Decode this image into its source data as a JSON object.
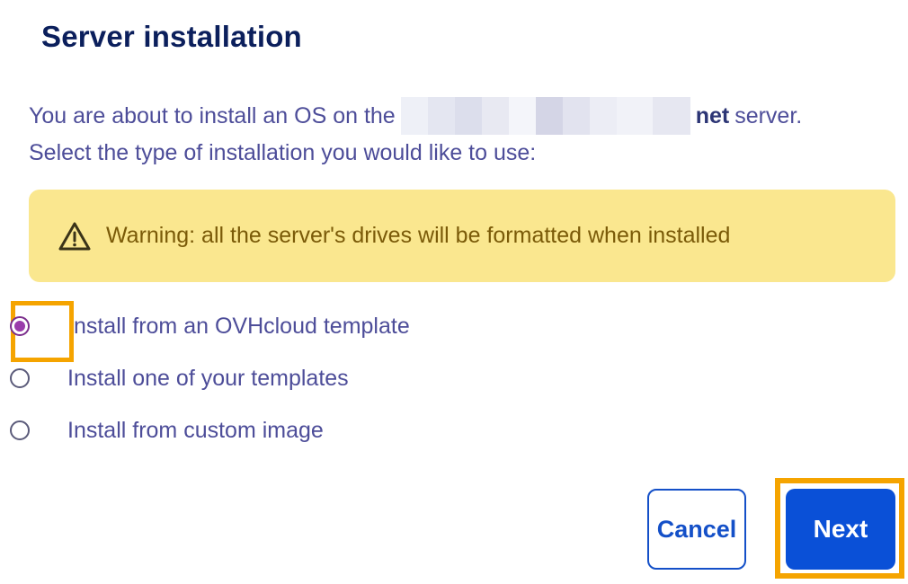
{
  "dialog": {
    "title": "Server installation",
    "intro_prefix": "You are about to install an OS on the",
    "server_name_suffix": "net",
    "intro_suffix": "server.",
    "intro_line2": "Select the type of installation you would like to use:"
  },
  "warning": {
    "icon": "warning-triangle-icon",
    "text": "Warning: all the server's drives will be formatted when installed",
    "background_color": "#fae78f",
    "text_color": "#7a5a08"
  },
  "install_options": {
    "selected_index": 0,
    "items": [
      {
        "label": "Install from an OVHcloud template",
        "checked": true
      },
      {
        "label": "Install one of your templates",
        "checked": false
      },
      {
        "label": "Install from custom image",
        "checked": false
      }
    ]
  },
  "buttons": {
    "cancel_label": "Cancel",
    "next_label": "Next"
  },
  "colors": {
    "primary": "#0a50d7",
    "title": "#0b1f5c",
    "highlight_frame": "#f5a400",
    "radio_selected": "#9a3bab"
  }
}
